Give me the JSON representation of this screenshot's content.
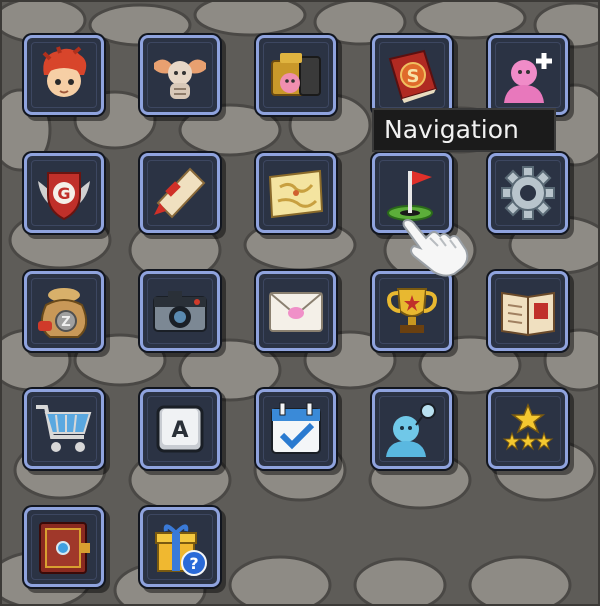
{
  "tooltip": {
    "text": "Navigation"
  },
  "colors": {
    "tile_bg": "#2b3344",
    "tile_border": "#8fa3de",
    "tooltip_bg": "#1b1b1b"
  },
  "menu": {
    "rows": [
      [
        "character-icon",
        "inventory-icon",
        "equipment-icon",
        "skill-book-icon",
        "add-friend-icon"
      ],
      [
        "guild-icon",
        "quest-scroll-icon",
        "world-map-icon",
        "navigation-flag-icon",
        "settings-gear-icon"
      ],
      [
        "money-bag-icon",
        "camera-icon",
        "mail-icon",
        "trophy-icon",
        "collection-book-icon"
      ],
      [
        "shop-cart-icon",
        "keyboard-key-icon",
        "calendar-icon",
        "chat-icon",
        "star-rank-icon"
      ],
      [
        "card-album-icon",
        "gift-help-icon"
      ]
    ]
  }
}
